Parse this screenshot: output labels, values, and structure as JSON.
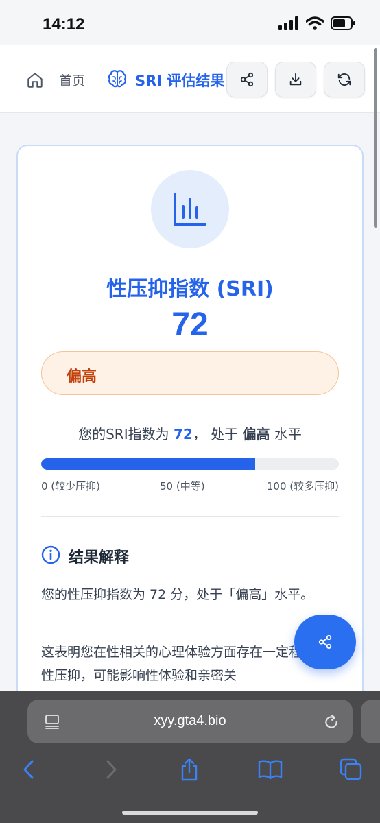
{
  "status_bar": {
    "time": "14:12"
  },
  "header": {
    "home_label": "首页",
    "title": "SRI 评估结果",
    "buttons": [
      "share",
      "download",
      "refresh"
    ]
  },
  "result": {
    "title": "性压抑指数 (SRI)",
    "score": "72",
    "level": "偏高",
    "summary_prefix": "您的SRI指数为",
    "summary_score": "72",
    "summary_mid": "， 处于",
    "summary_level": "偏高",
    "summary_suffix": "水平",
    "progress_percent": 72,
    "scale_low": "0 (较少压抑)",
    "scale_mid": "50 (中等)",
    "scale_high": "100 (较多压抑)"
  },
  "interpretation": {
    "title": "结果解释",
    "paragraph1": "您的性压抑指数为 72 分，处于「偏高」水平。",
    "paragraph2": "这表明您在性相关的心理体验方面存在一定程度的性压抑，可能影响性体验和亲密关"
  },
  "browser": {
    "url": "xyy.gta4.bio"
  },
  "colors": {
    "accent": "#2563eb",
    "warning_text": "#c2410c",
    "warning_bg": "#fef2e6"
  }
}
